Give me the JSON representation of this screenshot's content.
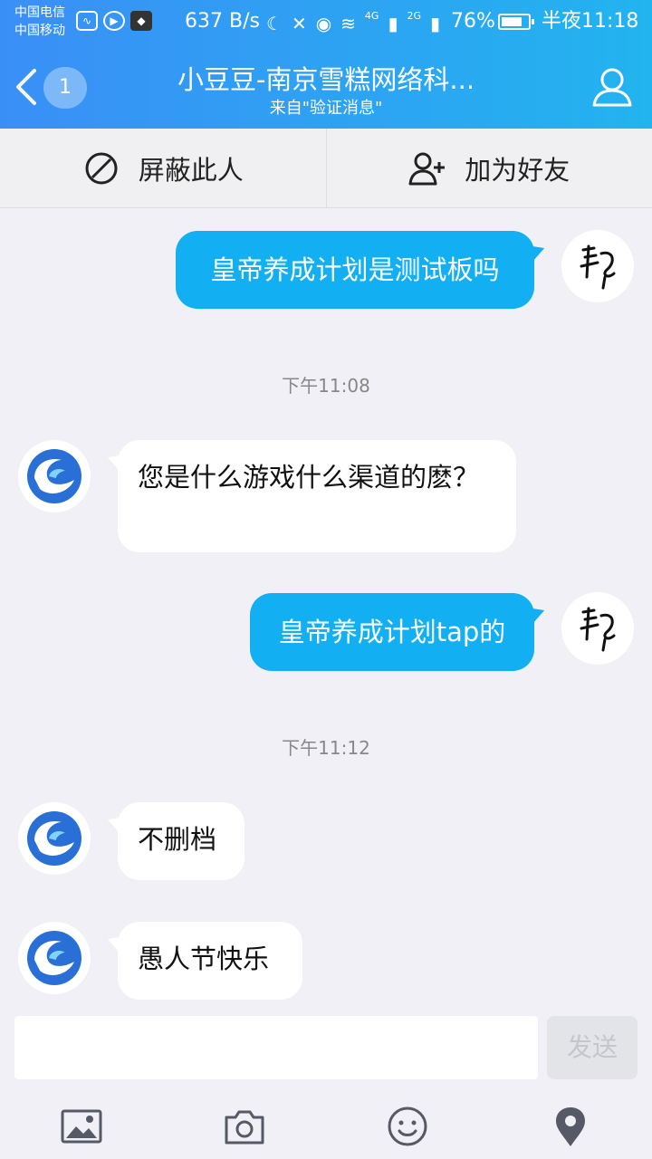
{
  "status_bar": {
    "carrier_1": "中国电信",
    "carrier_2": "中国移动",
    "net_speed": "637 B/s",
    "signal_1": "4G",
    "signal_2": "2G",
    "battery": "76%",
    "time": "半夜11:18"
  },
  "header": {
    "unread_count": "1",
    "title": "小豆豆-南京雪糕网络科...",
    "subtitle": "来自\"验证消息\""
  },
  "actions": {
    "block_label": "屏蔽此人",
    "add_friend_label": "加为好友"
  },
  "messages": [
    {
      "side": "out",
      "text": "皇帝养成计划是测试板吗"
    },
    {
      "type": "time",
      "text": "下午11:08"
    },
    {
      "side": "in",
      "text": "您是什么游戏什么渠道的麽？"
    },
    {
      "side": "out",
      "text": "皇帝养成计划tap的"
    },
    {
      "type": "time",
      "text": "下午11:12"
    },
    {
      "side": "in",
      "text": "不删档"
    },
    {
      "side": "in",
      "text": "愚人节快乐"
    }
  ],
  "input": {
    "value": "",
    "send_label": "发送"
  },
  "colors": {
    "header_start": "#3a8ff6",
    "header_end": "#22b4ef",
    "outgoing_bubble": "#12b0f2",
    "background": "#f0f0f6"
  },
  "icons": {
    "tools": [
      "image-icon",
      "camera-icon",
      "emoji-icon",
      "location-icon"
    ]
  }
}
